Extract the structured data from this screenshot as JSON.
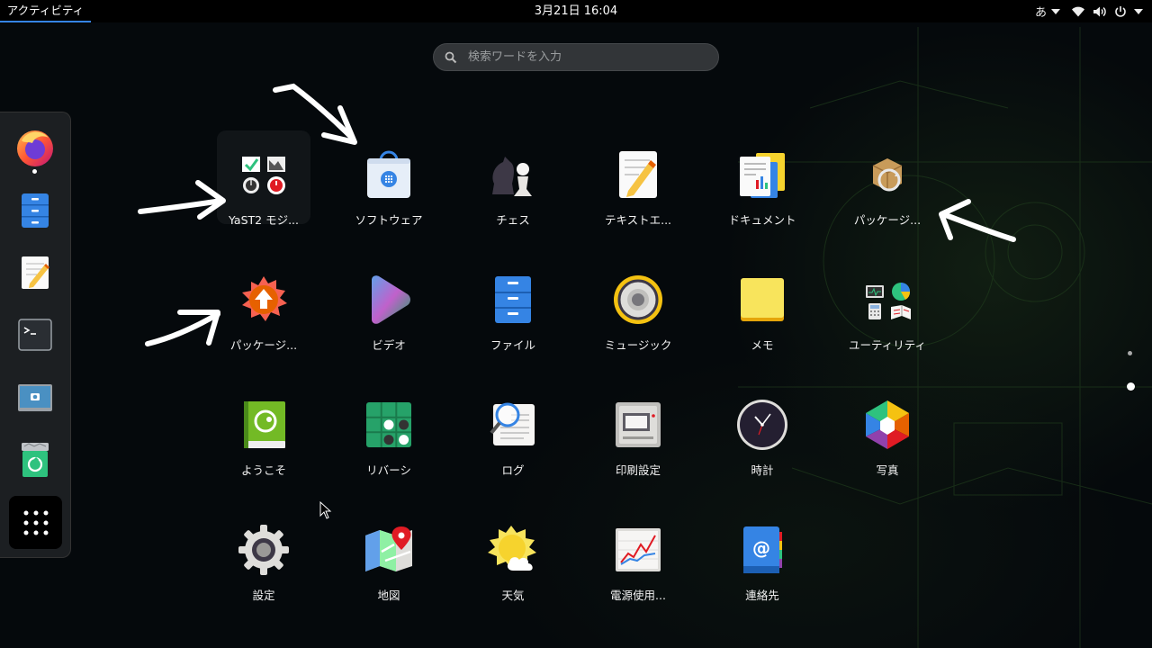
{
  "topbar": {
    "activities": "アクティビティ",
    "clock": "3月21日  16:04",
    "input_method": "あ"
  },
  "search": {
    "placeholder": "検索ワードを入力"
  },
  "dash": {
    "items": [
      {
        "name": "firefox",
        "icon": "firefox-icon",
        "running": true
      },
      {
        "name": "files",
        "icon": "files-cabinet-icon"
      },
      {
        "name": "text-editor",
        "icon": "text-editor-icon"
      },
      {
        "name": "terminal",
        "icon": "terminal-icon"
      },
      {
        "name": "screenshot",
        "icon": "screenshot-icon"
      },
      {
        "name": "trash",
        "icon": "trash-recycle-icon"
      }
    ],
    "show_apps_icon": "app-grid-icon"
  },
  "apps": [
    {
      "label": "YaST2 モジ...",
      "icon": "yast-folder-icon"
    },
    {
      "label": "ソフトウェア",
      "icon": "software-bag-icon"
    },
    {
      "label": "チェス",
      "icon": "chess-icon"
    },
    {
      "label": "テキストエ...",
      "icon": "text-editor-icon"
    },
    {
      "label": "ドキュメント",
      "icon": "document-viewer-icon"
    },
    {
      "label": "パッケージ...",
      "icon": "package-update-icon"
    },
    {
      "label": "パッケージ...",
      "icon": "package-updater-icon"
    },
    {
      "label": "ビデオ",
      "icon": "video-play-icon"
    },
    {
      "label": "ファイル",
      "icon": "files-cabinet-icon"
    },
    {
      "label": "ミュージック",
      "icon": "music-speaker-icon"
    },
    {
      "label": "メモ",
      "icon": "sticky-notes-icon"
    },
    {
      "label": "ユーティリティ",
      "icon": "utilities-folder-icon"
    },
    {
      "label": "ようこそ",
      "icon": "opensuse-welcome-icon"
    },
    {
      "label": "リバーシ",
      "icon": "reversi-icon"
    },
    {
      "label": "ログ",
      "icon": "logs-icon"
    },
    {
      "label": "印刷設定",
      "icon": "printer-icon"
    },
    {
      "label": "時計",
      "icon": "clock-icon"
    },
    {
      "label": "写真",
      "icon": "photos-icon"
    },
    {
      "label": "設定",
      "icon": "settings-gear-icon"
    },
    {
      "label": "地図",
      "icon": "maps-icon"
    },
    {
      "label": "天気",
      "icon": "weather-icon"
    },
    {
      "label": "電源使用...",
      "icon": "power-statistics-icon"
    },
    {
      "label": "連絡先",
      "icon": "contacts-icon"
    }
  ],
  "pages": {
    "count": 2,
    "current": 2
  },
  "colors": {
    "accent": "#3584e4",
    "topbar": "#000000",
    "dash": "#1c1f22"
  }
}
